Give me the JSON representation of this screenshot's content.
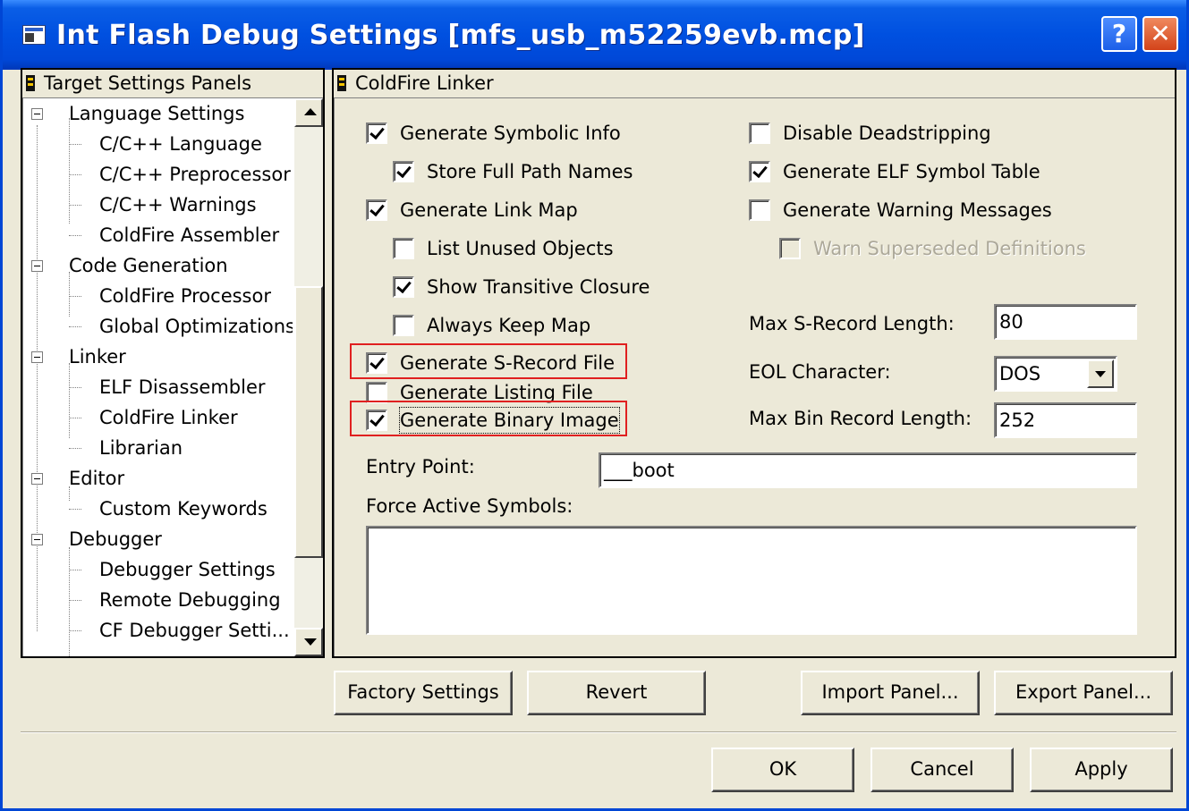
{
  "window": {
    "title": "Int Flash Debug Settings [mfs_usb_m52259evb.mcp]",
    "help_label": "?",
    "close_label": "✕"
  },
  "left_panel": {
    "header": "Target Settings Panels",
    "tree": [
      {
        "label": "Language Settings"
      },
      {
        "label": "C/C++ Language"
      },
      {
        "label": "C/C++ Preprocessor"
      },
      {
        "label": "C/C++ Warnings"
      },
      {
        "label": "ColdFire Assembler"
      },
      {
        "label": "Code Generation"
      },
      {
        "label": "ColdFire Processor"
      },
      {
        "label": "Global Optimizations"
      },
      {
        "label": "Linker"
      },
      {
        "label": "ELF Disassembler"
      },
      {
        "label": "ColdFire Linker"
      },
      {
        "label": "Librarian"
      },
      {
        "label": "Editor"
      },
      {
        "label": "Custom Keywords"
      },
      {
        "label": "Debugger"
      },
      {
        "label": "Debugger Settings"
      },
      {
        "label": "Remote Debugging"
      },
      {
        "label": "CF Debugger Setti..."
      }
    ]
  },
  "right_panel": {
    "header": "ColdFire Linker",
    "checkboxes": [
      {
        "label": "Generate Symbolic Info",
        "checked": true
      },
      {
        "label": "Store Full Path Names",
        "checked": true
      },
      {
        "label": "Generate Link Map",
        "checked": true
      },
      {
        "label": "List Unused Objects",
        "checked": false
      },
      {
        "label": "Show Transitive Closure",
        "checked": true
      },
      {
        "label": "Always Keep Map",
        "checked": false
      },
      {
        "label": "Generate S-Record File",
        "checked": true
      },
      {
        "label": "Generate Listing File",
        "checked": false
      },
      {
        "label": "Generate Binary Image",
        "checked": true
      },
      {
        "label": "Disable Deadstripping",
        "checked": false
      },
      {
        "label": "Generate ELF Symbol Table",
        "checked": true
      },
      {
        "label": "Generate Warning Messages",
        "checked": false
      },
      {
        "label": "Warn Superseded Definitions",
        "checked": false,
        "disabled": true
      }
    ],
    "max_srecord_label": "Max S-Record Length:",
    "max_srecord_value": "80",
    "eol_label": "EOL Character:",
    "eol_value": "DOS",
    "max_bin_label": "Max Bin Record Length:",
    "max_bin_value": "252",
    "entry_point_label": "Entry Point:",
    "entry_point_value": "___boot",
    "force_active_label": "Force Active Symbols:",
    "force_active_value": ""
  },
  "panel_buttons": {
    "factory": "Factory Settings",
    "revert": "Revert",
    "import": "Import Panel...",
    "export": "Export Panel..."
  },
  "dialog_buttons": {
    "ok": "OK",
    "cancel": "Cancel",
    "apply": "Apply"
  },
  "colors": {
    "titlebar": "#0050e0",
    "dialog_bg": "#ece9d8",
    "highlight_box": "#e02020"
  }
}
